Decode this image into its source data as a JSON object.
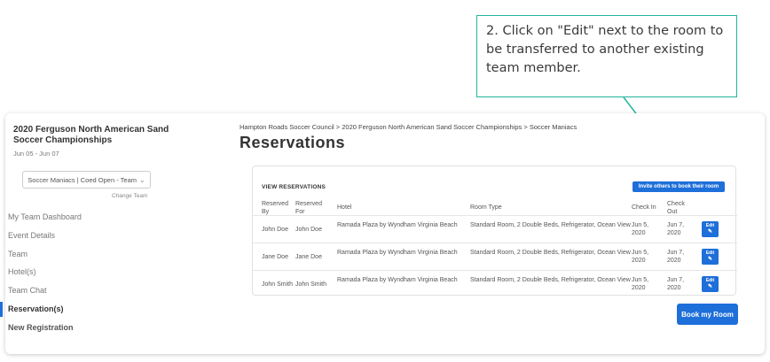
{
  "callout": {
    "text": "2. Click on \"Edit\" next to the room to be transferred to another existing team member."
  },
  "sidebar": {
    "event_title": "2020 Ferguson North American Sand Soccer Championships",
    "event_dates": "Jun 05 - Jun 07",
    "team_select_value": "Soccer Maniacs | Coed Open - Team",
    "change_team": "Change Team",
    "nav": [
      {
        "label": "My Team Dashboard"
      },
      {
        "label": "Event Details"
      },
      {
        "label": "Team"
      },
      {
        "label": "Hotel(s)"
      },
      {
        "label": "Team Chat"
      },
      {
        "label": "Reservation(s)"
      },
      {
        "label": "New Registration"
      }
    ]
  },
  "main": {
    "breadcrumb": "Hampton Roads Soccer Council > 2020 Ferguson North American Sand Soccer Championships > Soccer Maniacs",
    "title": "Reservations",
    "panel_label": "VIEW RESERVATIONS",
    "invite_label": "Invite others to book their room",
    "columns": {
      "reserved_by": "Reserved By",
      "reserved_for": "Reserved For",
      "hotel": "Hotel",
      "room_type": "Room Type",
      "check_in": "Check In",
      "check_out": "Check Out"
    },
    "rows": [
      {
        "reserved_by": "John Doe",
        "reserved_for": "John Doe",
        "hotel": "Ramada Plaza by Wyndham Virginia Beach",
        "room_type": "Standard Room, 2 Double Beds, Refrigerator, Ocean View",
        "check_in": "Jun 5, 2020",
        "check_out": "Jun 7, 2020",
        "edit": "Edit"
      },
      {
        "reserved_by": "Jane Doe",
        "reserved_for": "Jane Doe",
        "hotel": "Ramada Plaza by Wyndham Virginia Beach",
        "room_type": "Standard Room, 2 Double Beds, Refrigerator, Ocean View",
        "check_in": "Jun 5, 2020",
        "check_out": "Jun 7, 2020",
        "edit": "Edit"
      },
      {
        "reserved_by": "John Smith",
        "reserved_for": "John Smith",
        "hotel": "Ramada Plaza by Wyndham Virginia Beach",
        "room_type": "Standard Room, 2 Double Beds, Refrigerator, Ocean View",
        "check_in": "Jun 5, 2020",
        "check_out": "Jun 7, 2020",
        "edit": "Edit"
      }
    ],
    "book_label": "Book my Room"
  },
  "colors": {
    "accent": "#1e6fd9",
    "callout_border": "#1fb59d"
  },
  "icons": {
    "edit": "pencil-icon",
    "dropdown": "chevron-down-icon"
  }
}
